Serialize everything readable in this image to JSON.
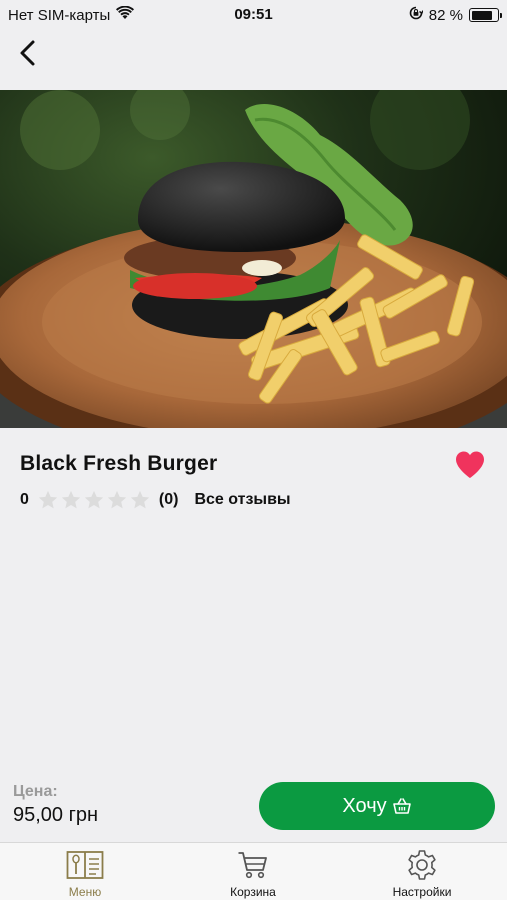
{
  "status_bar": {
    "carrier": "Нет SIM-карты",
    "time": "09:51",
    "battery_percent": "82 %",
    "battery_level": 0.82
  },
  "nav": {
    "back_icon": "chevron-left-icon"
  },
  "product": {
    "title": "Black Fresh Burger",
    "rating_value": "0",
    "stars_filled": 0,
    "stars_total": 5,
    "rating_count": "(0)",
    "reviews_link": "Все отзывы",
    "favorite": true
  },
  "footer": {
    "price_label": "Цена:",
    "price_value": "95,00 грн",
    "want_button": "Хочу"
  },
  "tabs": [
    {
      "label": "Меню",
      "icon": "menu-book-icon",
      "active": true
    },
    {
      "label": "Корзина",
      "icon": "cart-icon",
      "active": false
    },
    {
      "label": "Настройки",
      "icon": "gear-icon",
      "active": false
    }
  ],
  "colors": {
    "accent": "#0b9a41",
    "heart": "#f0335d",
    "active_tab": "#8b7d4a",
    "star_empty": "#dcdcdc",
    "background": "#efeff1"
  }
}
